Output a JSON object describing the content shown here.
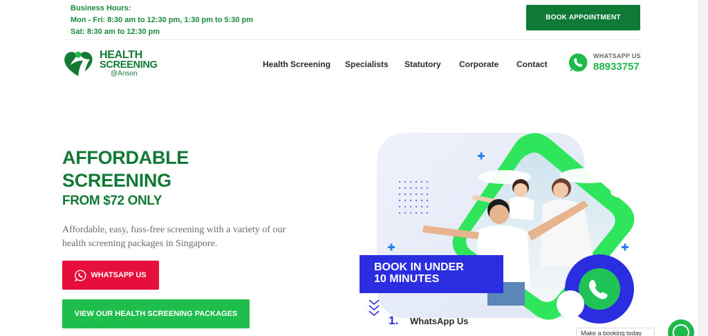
{
  "topbar": {
    "hours_title": "Business Hours:",
    "hours_weekday": "Mon - Fri: 8:30 am to 12:30 pm, 1:30 pm to 5:30 pm",
    "hours_sat": "Sat: 8:30 am to 12:30 pm",
    "book_label": "BOOK APPOINTMENT"
  },
  "logo": {
    "line1": "HEALTH",
    "line2": "SCREENING",
    "line3": "@Anson",
    "icon": "person-heart-logo"
  },
  "nav": {
    "items": [
      {
        "label": "Health Screening"
      },
      {
        "label": "Specialists"
      },
      {
        "label": "Statutory"
      },
      {
        "label": "Corporate"
      },
      {
        "label": "Contact"
      }
    ],
    "whatsapp_label": "WHATSAPP US",
    "whatsapp_number": "88933757",
    "whatsapp_icon": "whatsapp-icon"
  },
  "hero": {
    "title_line1": "AFFORDABLE",
    "title_line2": "SCREENING",
    "subtitle": "FROM $72 ONLY",
    "description": "Affordable, easy, fuss-free screening with a variety of our health screening packages in Singapore.",
    "whatsapp_button": "WHATSAPP US",
    "packages_button": "VIEW OUR HEALTH SCREENING PACKAGES"
  },
  "promo": {
    "banner_line1": "BOOK IN UNDER",
    "banner_line2": "10 MINUTES",
    "step1_num": "1.",
    "step1_label": "WhatsApp Us"
  },
  "float": {
    "tooltip": "Make a booking today"
  },
  "colors": {
    "brand_green": "#137a36",
    "button_green": "#1ebd4c",
    "dark_green": "#0f7a36",
    "whatsapp_red": "#e60f3c",
    "promo_blue": "#2b2ee0"
  }
}
